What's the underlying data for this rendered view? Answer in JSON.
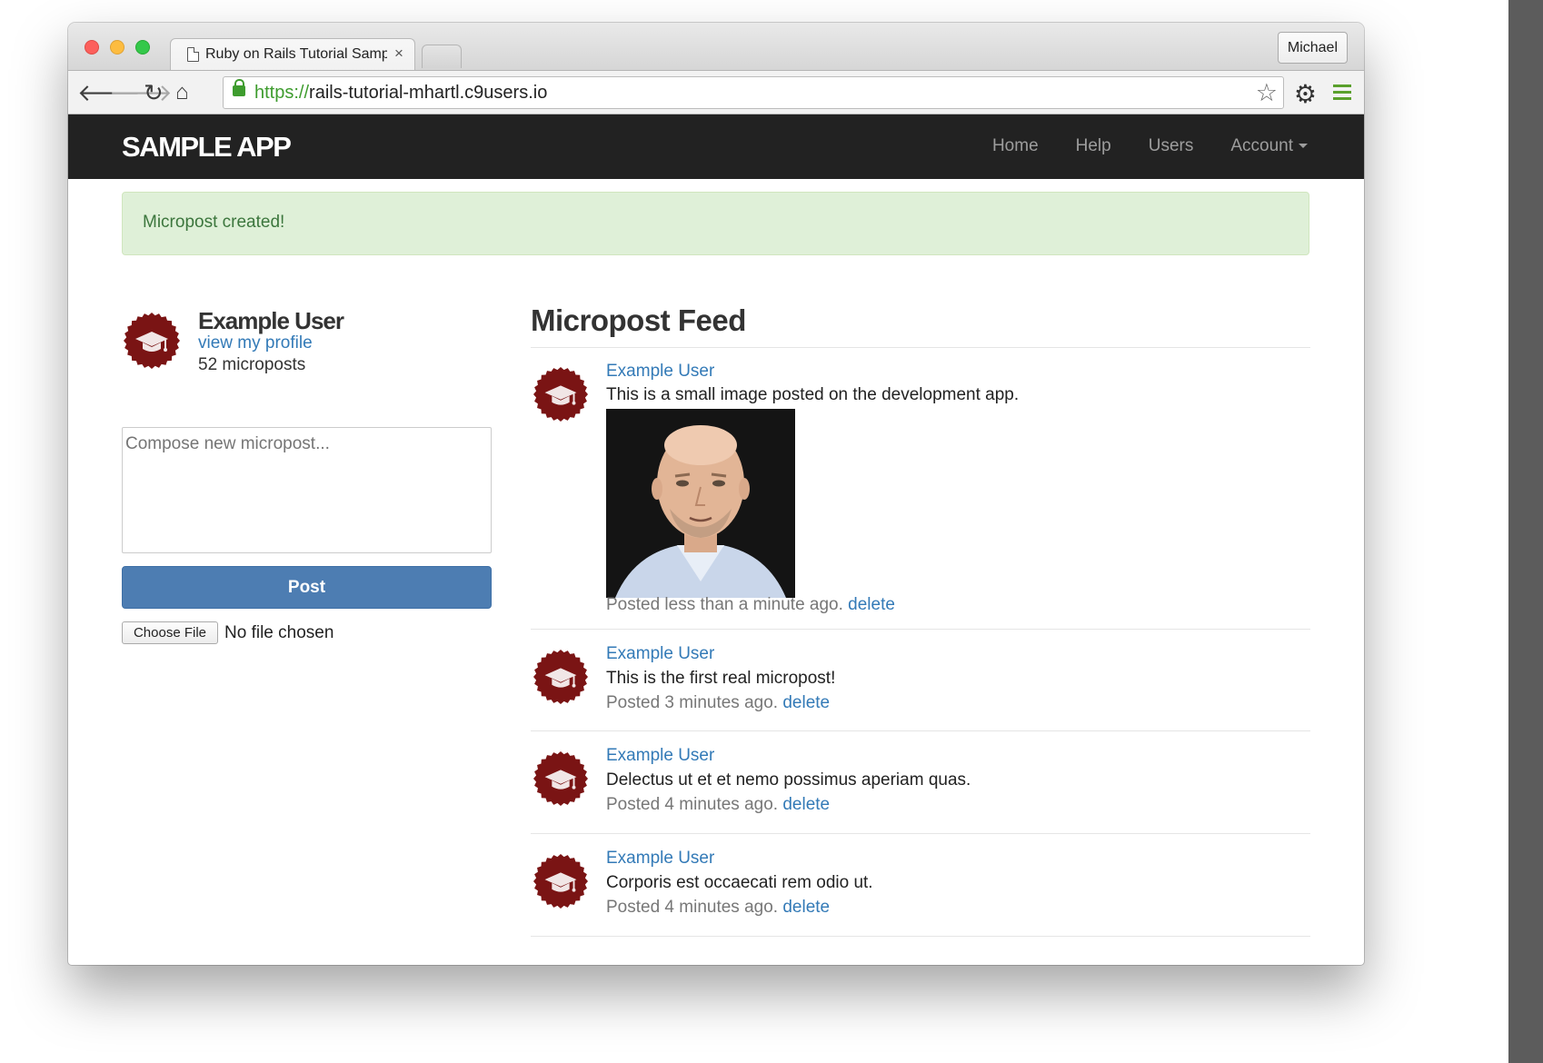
{
  "browser": {
    "tab_title": "Ruby on Rails Tutorial Samp",
    "profile_name": "Michael",
    "url_scheme": "https://",
    "url_host": "rails-tutorial-mhartl.c9users.io"
  },
  "navbar": {
    "logo": "SAMPLE APP",
    "links": [
      "Home",
      "Help",
      "Users",
      "Account"
    ]
  },
  "flash": {
    "message": "Micropost created!"
  },
  "sidebar": {
    "user_name": "Example User",
    "profile_link": "view my profile",
    "micropost_count": "52 microposts",
    "compose_placeholder": "Compose new micropost...",
    "post_button": "Post",
    "choose_file_button": "Choose File",
    "file_status": "No file chosen"
  },
  "feed": {
    "title": "Micropost Feed",
    "posts": [
      {
        "user": "Example User",
        "content": "This is a small image posted on the development app.",
        "timestamp": "Posted less than a minute ago.",
        "delete": "delete",
        "has_image": true
      },
      {
        "user": "Example User",
        "content": "This is the first real micropost!",
        "timestamp": "Posted 3 minutes ago.",
        "delete": "delete"
      },
      {
        "user": "Example User",
        "content": "Delectus ut et et nemo possimus aperiam quas.",
        "timestamp": "Posted 4 minutes ago.",
        "delete": "delete"
      },
      {
        "user": "Example User",
        "content": "Corporis est occaecati rem odio ut.",
        "timestamp": "Posted 4 minutes ago.",
        "delete": "delete"
      }
    ]
  },
  "colors": {
    "navbar_bg": "#222222",
    "link": "#337ab7",
    "primary_button": "#4d7db2",
    "flash_bg": "#dff0d8",
    "avatar": "#7a1414"
  }
}
